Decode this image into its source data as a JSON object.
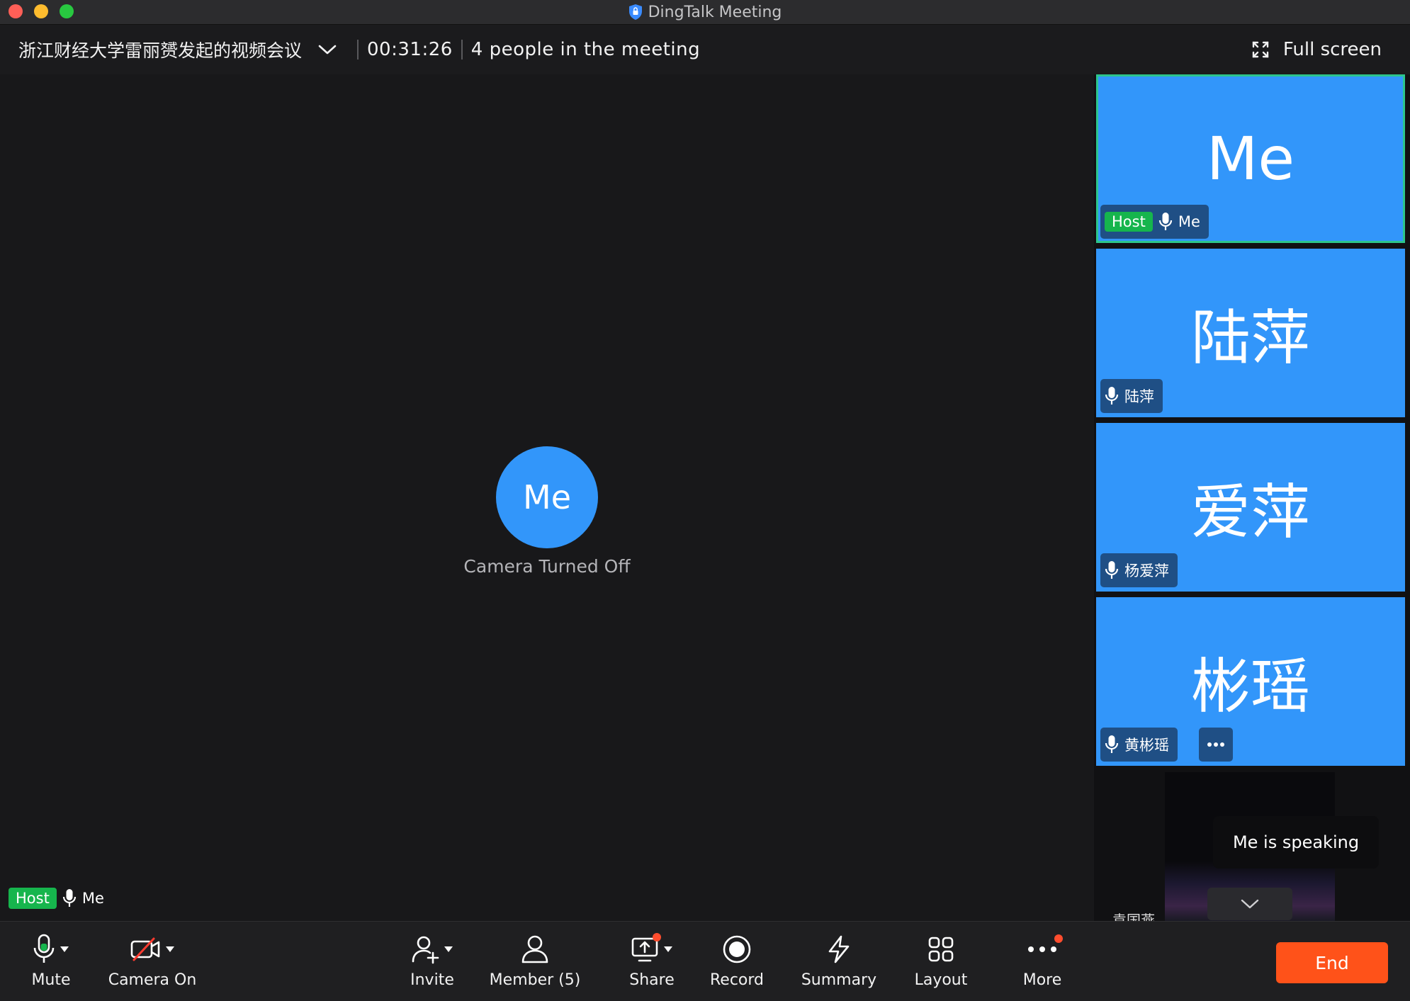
{
  "window": {
    "title": "DingTalk Meeting"
  },
  "header": {
    "meeting_name": "浙江财经大学雷丽赟发起的视频会议",
    "timer": "00:31:26",
    "people": "4 people in the meeting",
    "fullscreen_label": "Full screen"
  },
  "stage": {
    "avatar_text": "Me",
    "camera_status": "Camera Turned Off",
    "host_badge": "Host",
    "name": "Me"
  },
  "side": {
    "tiles": [
      {
        "big": "Me",
        "host_badge": "Host",
        "name": "Me"
      },
      {
        "big": "陆萍",
        "name": "陆萍"
      },
      {
        "big": "爱萍",
        "name": "杨爱萍"
      },
      {
        "big": "彬瑶",
        "name": "黄彬瑶"
      }
    ],
    "speaking": "Me  is speaking",
    "cut_name": "袁国燕"
  },
  "toolbar": {
    "mute": "Mute",
    "camera": "Camera On",
    "invite": "Invite",
    "member": "Member (5)",
    "share": "Share",
    "record": "Record",
    "summary": "Summary",
    "layout": "Layout",
    "more": "More",
    "end": "End"
  },
  "colors": {
    "accent_blue": "#3296fa",
    "host_green": "#16b54d",
    "end_orange": "#ff5219",
    "notification_red": "#ff4d2e"
  }
}
